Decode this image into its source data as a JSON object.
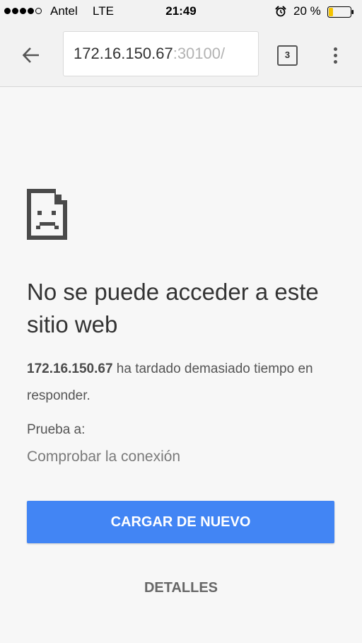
{
  "status_bar": {
    "carrier": "Antel",
    "network": "LTE",
    "time": "21:49",
    "battery_percent": "20 %",
    "battery_level": 0.2,
    "battery_color": "#f5c400",
    "signal_bars_filled": 4,
    "signal_bars_total": 5
  },
  "toolbar": {
    "url_host": "172.16.150.67",
    "url_port": ":30100/",
    "tab_count": "3",
    "back_icon": "arrow-back-icon",
    "menu_icon": "overflow-menu-icon"
  },
  "error_page": {
    "icon": "sad-page-icon",
    "heading": "No se puede acceder a este sitio web",
    "host": "172.16.150.67",
    "message": " ha tardado demasiado tiempo en responder.",
    "try_label": "Prueba a:",
    "suggestion": "Comprobar la conexión",
    "reload_label": "CARGAR DE NUEVO",
    "details_label": "DETALLES"
  },
  "colors": {
    "accent": "#4285f4",
    "background": "#f7f7f7",
    "toolbar": "#f2f2f2"
  }
}
